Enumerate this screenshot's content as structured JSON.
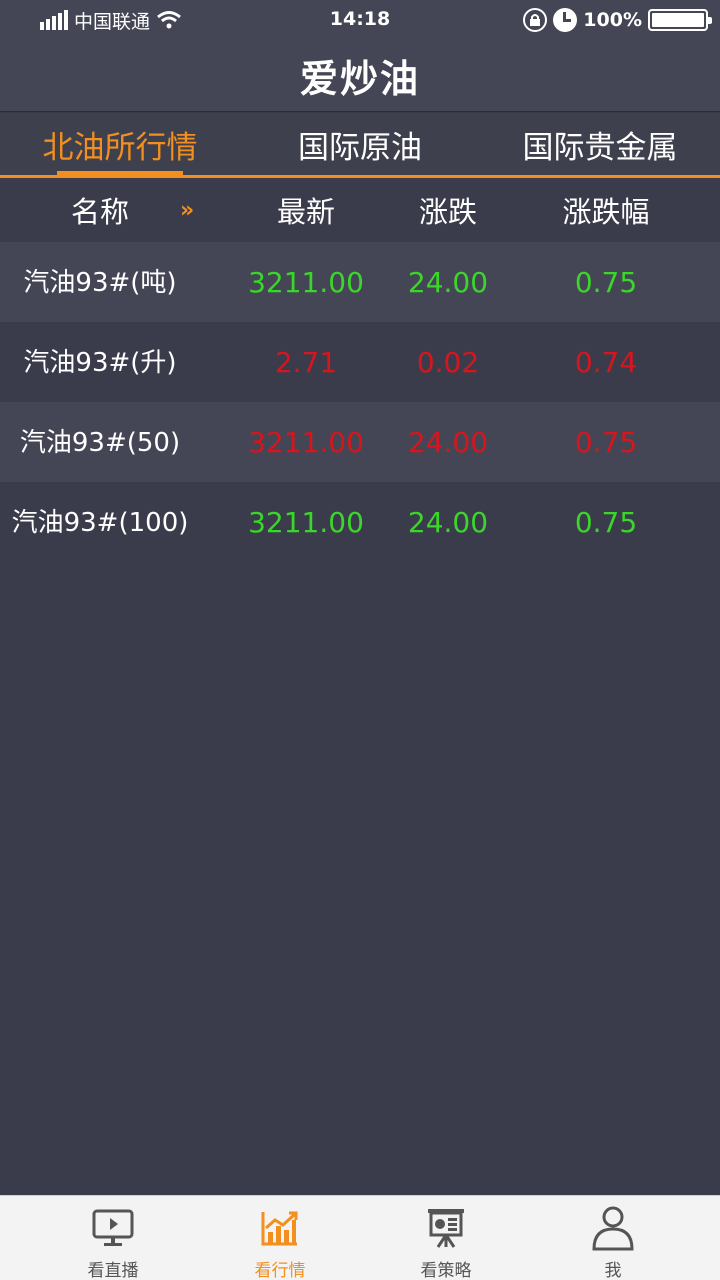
{
  "status_bar": {
    "carrier": "中国联通",
    "time": "14:18",
    "battery": "100%"
  },
  "nav": {
    "title": "爱炒油"
  },
  "tabs": [
    {
      "label": "北油所行情",
      "active": true
    },
    {
      "label": "国际原油",
      "active": false
    },
    {
      "label": "国际贵金属",
      "active": false
    }
  ],
  "table": {
    "headers": {
      "name": "名称",
      "latest": "最新",
      "change": "涨跌",
      "change_pct": "涨跌幅"
    },
    "sort_indicator": "»",
    "rows": [
      {
        "name": "汽油93#(吨)",
        "latest": "3211.00",
        "change": "24.00",
        "change_pct": "0.75",
        "trend": "up"
      },
      {
        "name": "汽油93#(升)",
        "latest": "2.71",
        "change": "0.02",
        "change_pct": "0.74",
        "trend": "down"
      },
      {
        "name": "汽油93#(50)",
        "latest": "3211.00",
        "change": "24.00",
        "change_pct": "0.75",
        "trend": "down"
      },
      {
        "name": "汽油93#(100)",
        "latest": "3211.00",
        "change": "24.00",
        "change_pct": "0.75",
        "trend": "up"
      }
    ]
  },
  "tabbar": [
    {
      "label": "看直播",
      "icon": "live-tv-icon",
      "active": false
    },
    {
      "label": "看行情",
      "icon": "market-chart-icon",
      "active": true
    },
    {
      "label": "看策略",
      "icon": "strategy-board-icon",
      "active": false
    },
    {
      "label": "我",
      "icon": "user-profile-icon",
      "active": false
    }
  ],
  "colors": {
    "accent": "#f28f1e",
    "up": "#3ad62a",
    "down": "#d7151d",
    "background": "#3b3c4b"
  }
}
